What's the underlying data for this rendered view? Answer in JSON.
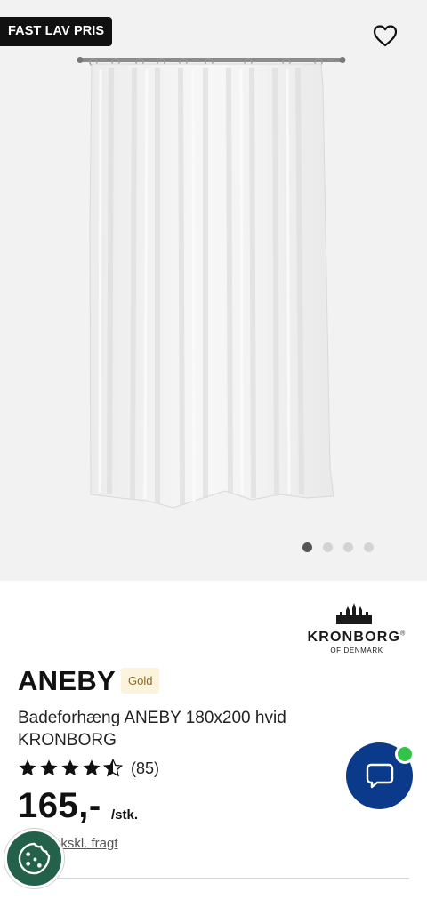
{
  "gallery": {
    "badge": "FAST LAV PRIS",
    "favorite_icon": "heart-outline-icon",
    "image": "shower-curtain-image",
    "slides_total": 4,
    "slide_active": 1
  },
  "brand": {
    "name": "KRONBORG",
    "registered": "®",
    "tagline": "OF DENMARK",
    "logo_icon": "castle-skyline-icon"
  },
  "product": {
    "title": "ANEBY",
    "tier": "Gold",
    "description": "Badeforhæng ANEBY 180x200 hvid KRONBORG",
    "rating": 4.5,
    "rating_max": 5,
    "review_count": "(85)",
    "price": "165,-",
    "unit": "/stk.",
    "freight": "ekskl. fragt"
  },
  "chat": {
    "icon": "chat-bubble-icon",
    "status_color": "#34c34a"
  },
  "cookie": {
    "icon": "cookie-icon"
  },
  "colors": {
    "chat_bg": "#0b3a8a",
    "cookie_bg": "#23614b",
    "tier_bg": "#fbf3dc",
    "tier_text": "#8a6a1d"
  }
}
